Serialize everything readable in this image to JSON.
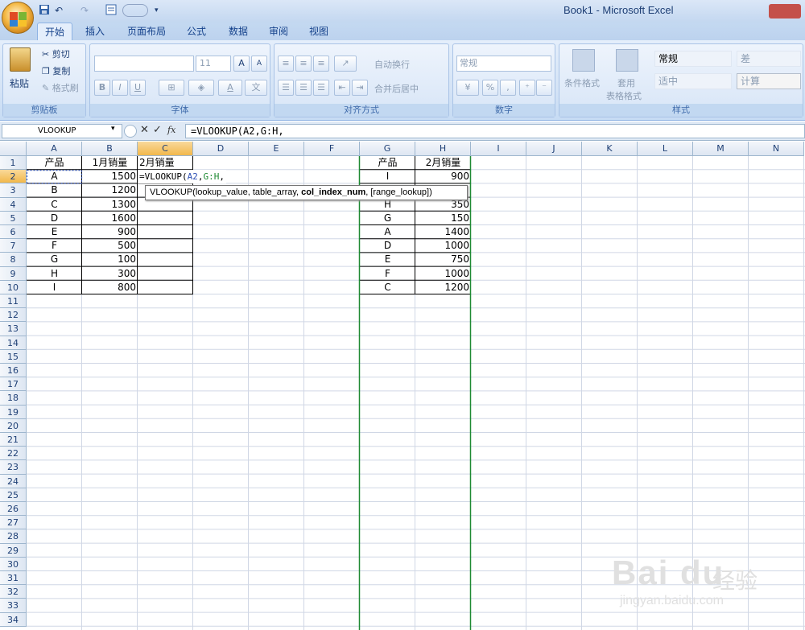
{
  "window": {
    "title": "Book1 - Microsoft Excel"
  },
  "qat": {
    "undo": "↶",
    "redo": "↷"
  },
  "tabs": [
    "开始",
    "插入",
    "页面布局",
    "公式",
    "数据",
    "审阅",
    "视图"
  ],
  "ribbon": {
    "clipboard": {
      "paste": "粘贴",
      "cut": "剪切",
      "copy": "复制",
      "format_painter": "格式刷",
      "label": "剪贴板"
    },
    "font": {
      "size": "11",
      "label": "字体",
      "grow": "A",
      "shrink": "A",
      "bold": "B",
      "italic": "I",
      "underline": "U"
    },
    "align": {
      "wrap": "自动换行",
      "merge": "合并后居中",
      "label": "对齐方式"
    },
    "number": {
      "format": "常规",
      "percent": "%",
      "comma": ",",
      "label": "数字"
    },
    "styles": {
      "conditional": "条件格式",
      "table_format_1": "套用",
      "table_format_2": "表格格式",
      "normal": "常规",
      "bad": "差",
      "neutral": "适中",
      "calc": "计算",
      "label": "样式"
    }
  },
  "formula_bar": {
    "name_box": "VLOOKUP",
    "fx": "fx",
    "formula": "=VLOOKUP(A2,G:H,"
  },
  "columns": [
    "A",
    "B",
    "C",
    "D",
    "E",
    "F",
    "G",
    "H",
    "I",
    "J",
    "K",
    "L",
    "M",
    "N"
  ],
  "rows": [
    "1",
    "2",
    "3",
    "4",
    "5",
    "6",
    "7",
    "8",
    "9",
    "10",
    "11",
    "12",
    "13",
    "14",
    "15",
    "16",
    "17",
    "18",
    "19",
    "20",
    "21",
    "22",
    "23",
    "24",
    "25",
    "26",
    "27",
    "28",
    "29",
    "30",
    "31",
    "32",
    "33",
    "34"
  ],
  "table1": {
    "headers": [
      "产品",
      "1月销量",
      "2月销量"
    ],
    "rows": [
      [
        "A",
        "1500"
      ],
      [
        "B",
        "1200"
      ],
      [
        "C",
        "1300"
      ],
      [
        "D",
        "1600"
      ],
      [
        "E",
        "900"
      ],
      [
        "F",
        "500"
      ],
      [
        "G",
        "100"
      ],
      [
        "H",
        "300"
      ],
      [
        "I",
        "800"
      ]
    ]
  },
  "table2": {
    "headers": [
      "产品",
      "2月销量"
    ],
    "rows": [
      [
        "I",
        "900"
      ],
      [
        "H",
        "350"
      ],
      [
        "G",
        "150"
      ],
      [
        "A",
        "1400"
      ],
      [
        "D",
        "1000"
      ],
      [
        "E",
        "750"
      ],
      [
        "F",
        "1000"
      ],
      [
        "C",
        "1200"
      ]
    ]
  },
  "editing_cell": {
    "prefix": "=VLOOKUP(",
    "arg1": "A2",
    "sep": ",",
    "arg2": "G:H",
    "tail": ","
  },
  "tooltip": {
    "func": "VLOOKUP(",
    "a1": "lookup_value, ",
    "a2": "table_array, ",
    "a3": "col_index_num",
    "a4": ", [range_lookup])"
  },
  "watermark": {
    "brand": "Bai du",
    "cn": "经验",
    "url": "jingyan.baidu.com"
  }
}
